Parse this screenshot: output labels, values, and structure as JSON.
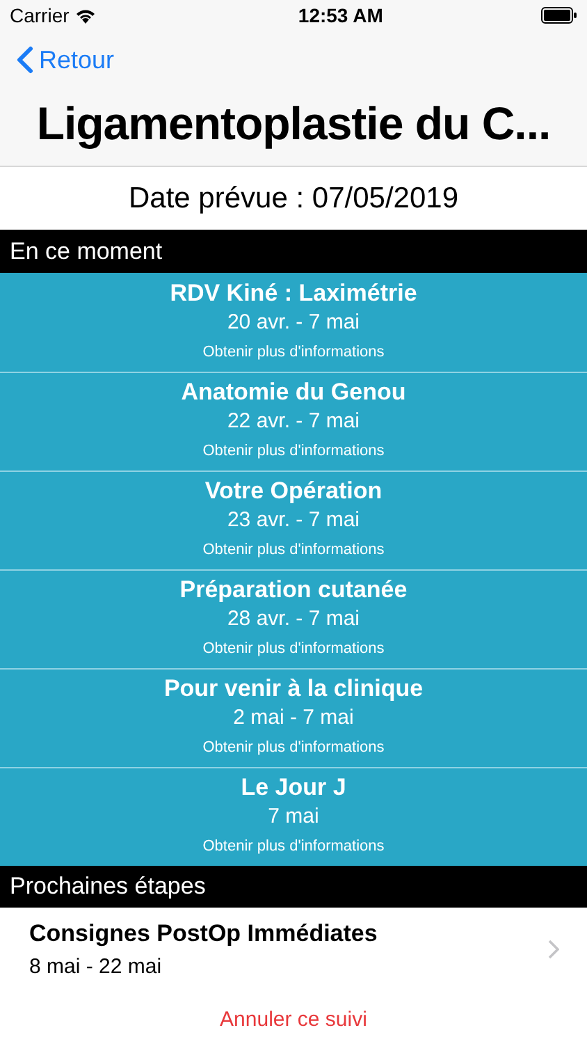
{
  "status_bar": {
    "carrier": "Carrier",
    "time": "12:53 AM"
  },
  "nav": {
    "back": "Retour",
    "title": "Ligamentoplastie du C..."
  },
  "planned_date": "Date prévue : 07/05/2019",
  "current": {
    "header": "En ce moment",
    "items": [
      {
        "title": "RDV Kiné : Laximétrie",
        "dates": "20 avr. - 7 mai",
        "link": "Obtenir plus d'informations"
      },
      {
        "title": "Anatomie du Genou",
        "dates": "22 avr. - 7 mai",
        "link": "Obtenir plus d'informations"
      },
      {
        "title": "Votre Opération",
        "dates": "23 avr. - 7 mai",
        "link": "Obtenir plus d'informations"
      },
      {
        "title": "Préparation cutanée",
        "dates": "28 avr. - 7 mai",
        "link": "Obtenir plus d'informations"
      },
      {
        "title": "Pour venir à la clinique",
        "dates": "2 mai - 7 mai",
        "link": "Obtenir plus d'informations"
      },
      {
        "title": "Le Jour J",
        "dates": "7 mai",
        "link": "Obtenir plus d'informations"
      }
    ]
  },
  "next": {
    "header": "Prochaines étapes",
    "items": [
      {
        "title": "Consignes PostOp Immédiates",
        "dates": "8 mai - 22 mai"
      }
    ]
  },
  "cancel": "Annuler ce suivi"
}
